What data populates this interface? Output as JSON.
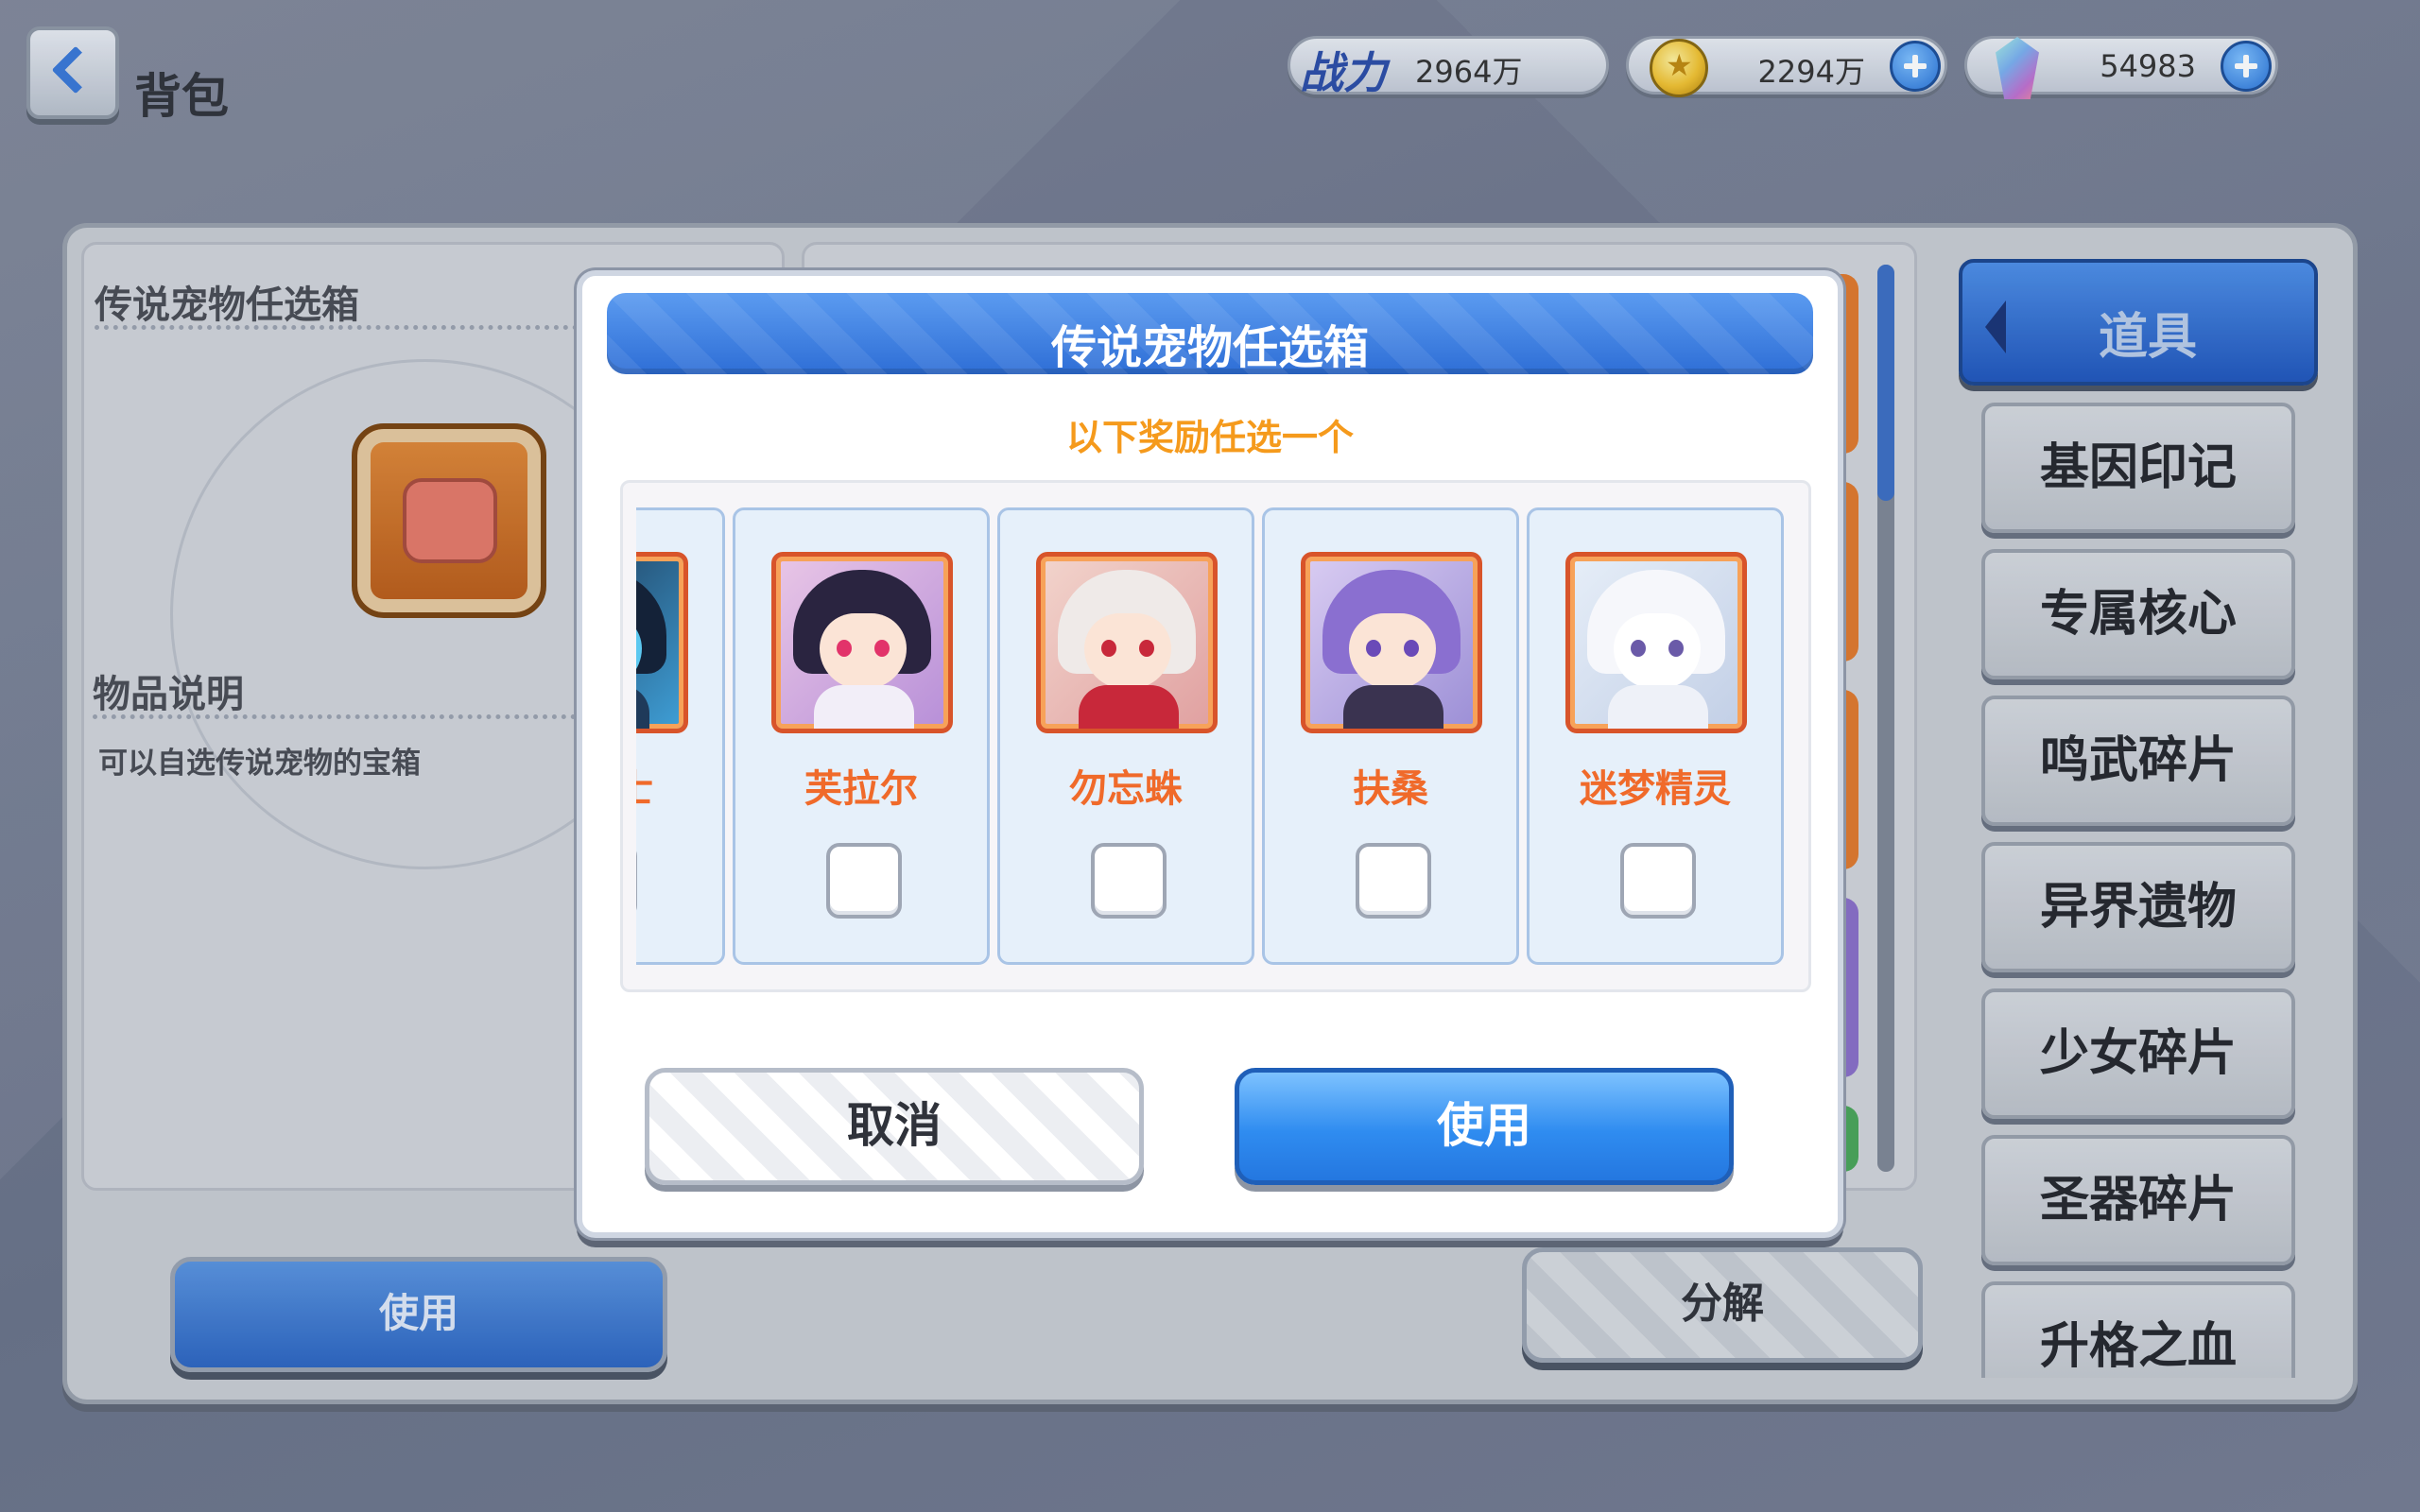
{
  "header": {
    "page_title": "背包",
    "power_label": "战力",
    "power_value": "2964万",
    "gold_value": "2294万",
    "gem_value": "54983"
  },
  "item_panel": {
    "item_name": "传说宠物任选箱",
    "desc_title": "物品说明",
    "desc_text": "可以自选传说宠物的宝箱"
  },
  "bottom_buttons": {
    "use": "使用",
    "decompose": "分解"
  },
  "categories": {
    "header": "道具",
    "items": [
      "基因印记",
      "专属核心",
      "鸣武碎片",
      "异界遗物",
      "少女碎片",
      "圣器碎片",
      "升格之血"
    ]
  },
  "dialog": {
    "title": "传说宠物任选箱",
    "subtitle": "以下奖励任选一个",
    "options": [
      {
        "name": "金战士",
        "checked": false
      },
      {
        "name": "芙拉尔",
        "checked": false
      },
      {
        "name": "勿忘蛛",
        "checked": false
      },
      {
        "name": "扶桑",
        "checked": false
      },
      {
        "name": "迷梦精灵",
        "checked": false
      }
    ],
    "cancel_label": "取消",
    "use_label": "使用"
  },
  "colors": {
    "accent_blue": "#2f8cf0",
    "option_name": "#f06a2a",
    "subtitle": "#f59a1c"
  }
}
